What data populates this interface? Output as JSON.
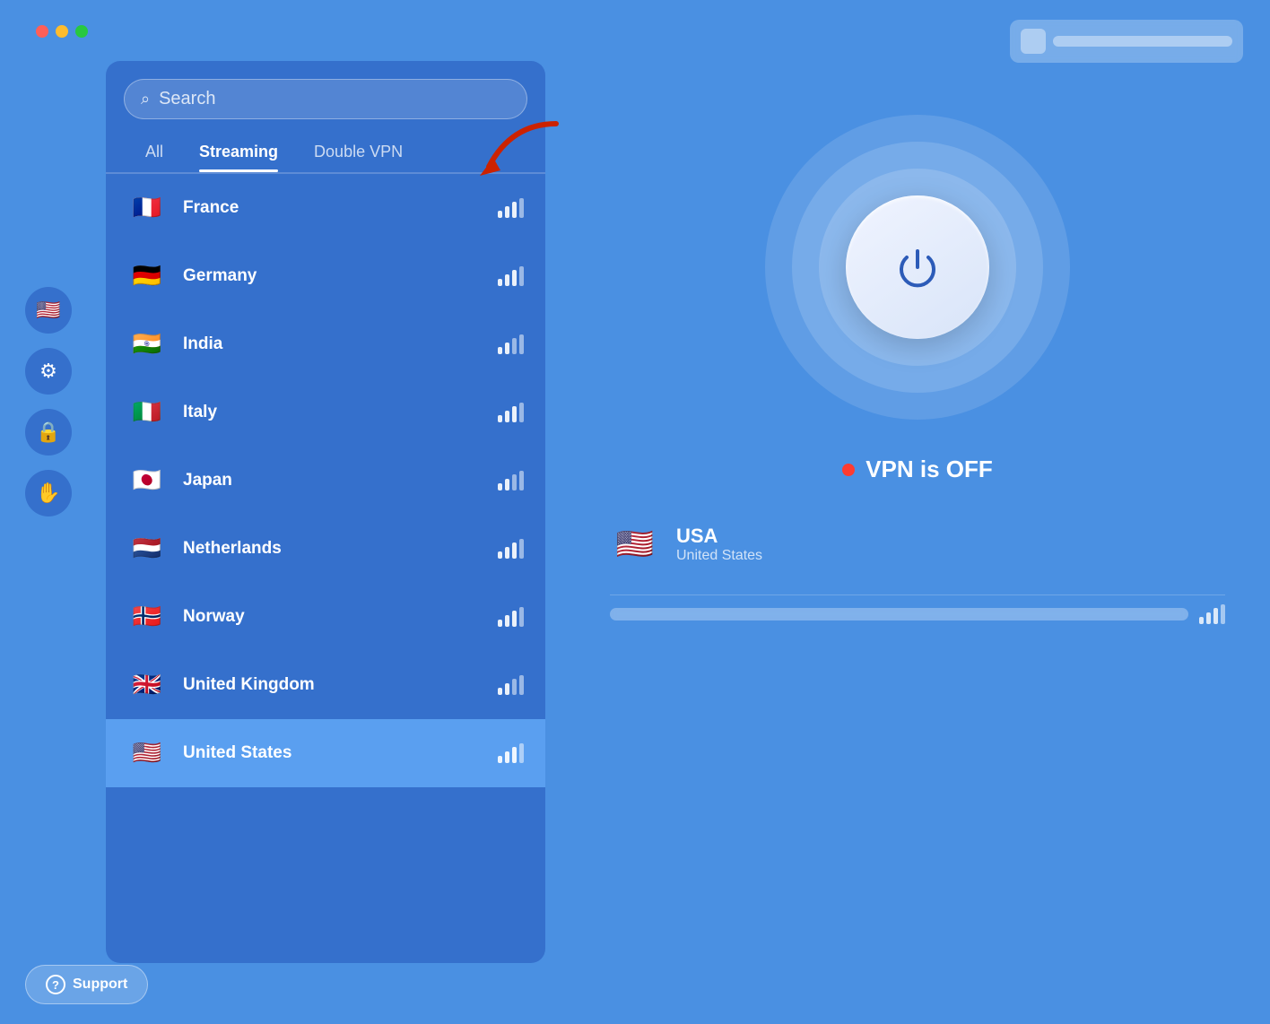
{
  "window": {
    "background_color": "#4a8fe8"
  },
  "traffic_lights": {
    "red": "red",
    "yellow": "yellow",
    "green": "green"
  },
  "search": {
    "placeholder": "Search",
    "icon": "🔍"
  },
  "tabs": [
    {
      "id": "all",
      "label": "All",
      "active": false
    },
    {
      "id": "streaming",
      "label": "Streaming",
      "active": true
    },
    {
      "id": "double_vpn",
      "label": "Double VPN",
      "active": false
    }
  ],
  "countries": [
    {
      "name": "France",
      "flag": "🇫🇷",
      "signal": 3,
      "selected": false
    },
    {
      "name": "Germany",
      "flag": "🇩🇪",
      "signal": 3,
      "selected": false
    },
    {
      "name": "India",
      "flag": "🇮🇳",
      "signal": 2,
      "selected": false
    },
    {
      "name": "Italy",
      "flag": "🇮🇹",
      "signal": 3,
      "selected": false
    },
    {
      "name": "Japan",
      "flag": "🇯🇵",
      "signal": 2,
      "selected": false
    },
    {
      "name": "Netherlands",
      "flag": "🇳🇱",
      "signal": 3,
      "selected": false
    },
    {
      "name": "Norway",
      "flag": "🇳🇴",
      "signal": 3,
      "selected": false
    },
    {
      "name": "United Kingdom",
      "flag": "🇬🇧",
      "signal": 2,
      "selected": false
    },
    {
      "name": "United States",
      "flag": "🇺🇸",
      "signal": 3,
      "selected": true
    }
  ],
  "sidebar": {
    "items": [
      {
        "id": "country",
        "icon": "🇺🇸"
      },
      {
        "id": "settings",
        "icon": "⚙️"
      },
      {
        "id": "lock",
        "icon": "🔒"
      },
      {
        "id": "hand",
        "icon": "✋"
      }
    ]
  },
  "vpn": {
    "status": "VPN is OFF",
    "status_dot_color": "#ff3b30",
    "selected_country": "USA",
    "selected_country_sub": "United States",
    "selected_flag": "🇺🇸"
  },
  "support": {
    "label": "Support",
    "icon": "?"
  },
  "arrow": {
    "pointing_to": "Streaming tab"
  }
}
